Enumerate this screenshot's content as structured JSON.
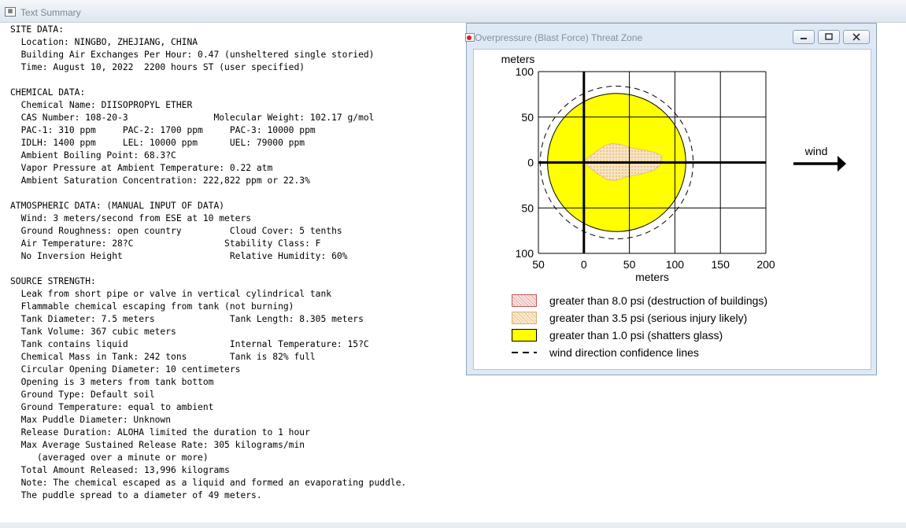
{
  "window": {
    "title": "Text Summary"
  },
  "report": {
    "lines": [
      "SITE DATA:",
      "  Location: NINGBO, ZHEJIANG, CHINA",
      "  Building Air Exchanges Per Hour: 0.47 (unsheltered single storied)",
      "  Time: August 10, 2022  2200 hours ST (user specified)",
      "",
      "CHEMICAL DATA:",
      "  Chemical Name: DIISOPROPYL ETHER",
      "  CAS Number: 108-20-3                Molecular Weight: 102.17 g/mol",
      "  PAC-1: 310 ppm     PAC-2: 1700 ppm     PAC-3: 10000 ppm",
      "  IDLH: 1400 ppm     LEL: 10000 ppm      UEL: 79000 ppm",
      "  Ambient Boiling Point: 68.3?C",
      "  Vapor Pressure at Ambient Temperature: 0.22 atm",
      "  Ambient Saturation Concentration: 222,822 ppm or 22.3%",
      "",
      "ATMOSPHERIC DATA: (MANUAL INPUT OF DATA)",
      "  Wind: 3 meters/second from ESE at 10 meters",
      "  Ground Roughness: open country         Cloud Cover: 5 tenths",
      "  Air Temperature: 28?C                 Stability Class: F",
      "  No Inversion Height                    Relative Humidity: 60%",
      "",
      "SOURCE STRENGTH:",
      "  Leak from short pipe or valve in vertical cylindrical tank",
      "  Flammable chemical escaping from tank (not burning)",
      "  Tank Diameter: 7.5 meters              Tank Length: 8.305 meters",
      "  Tank Volume: 367 cubic meters",
      "  Tank contains liquid                   Internal Temperature: 15?C",
      "  Chemical Mass in Tank: 242 tons        Tank is 82% full",
      "  Circular Opening Diameter: 10 centimeters",
      "  Opening is 3 meters from tank bottom",
      "  Ground Type: Default soil",
      "  Ground Temperature: equal to ambient",
      "  Max Puddle Diameter: Unknown",
      "  Release Duration: ALOHA limited the duration to 1 hour",
      "  Max Average Sustained Release Rate: 305 kilograms/min",
      "     (averaged over a minute or more)",
      "  Total Amount Released: 13,996 kilograms",
      "  Note: The chemical escaped as a liquid and formed an evaporating puddle.",
      "  The puddle spread to a diameter of 49 meters."
    ]
  },
  "threat_window": {
    "title": "Overpressure (Blast Force) Threat Zone",
    "buttons": [
      "minimize-icon",
      "maximize-icon",
      "close-icon"
    ]
  },
  "chart_data": {
    "type": "area",
    "xlabel": "meters",
    "ylabel": "meters",
    "xlim": [
      -50,
      200
    ],
    "ylim": [
      -100,
      100
    ],
    "x_ticks": [
      -50,
      0,
      50,
      100,
      150,
      200
    ],
    "x_tick_labels": [
      "50",
      "0",
      "50",
      "100",
      "150",
      "200"
    ],
    "y_ticks": [
      100,
      50,
      0,
      -50,
      -100
    ],
    "y_tick_labels": [
      "100",
      "50",
      "0",
      "50",
      "100"
    ],
    "grid": true,
    "wind_label": "wind",
    "zones": [
      {
        "name": "greater than 8.0 psi (destruction of buildings)",
        "color": "#f4c8c8",
        "points": []
      },
      {
        "name": "greater than 3.5 psi (serious injury likely)",
        "color": "#f6ddb4",
        "points": [
          [
            0,
            0
          ],
          [
            4,
            5
          ],
          [
            12,
            11
          ],
          [
            22,
            18
          ],
          [
            30,
            21
          ],
          [
            40,
            20
          ],
          [
            52,
            16
          ],
          [
            64,
            14
          ],
          [
            78,
            11
          ],
          [
            86,
            7
          ],
          [
            84,
            -3
          ],
          [
            76,
            -9
          ],
          [
            62,
            -13
          ],
          [
            46,
            -16
          ],
          [
            34,
            -20
          ],
          [
            26,
            -19
          ],
          [
            16,
            -13
          ],
          [
            8,
            -7
          ],
          [
            3,
            -3
          ]
        ]
      },
      {
        "name": "greater than 1.0 psi (shatters glass)",
        "color": "#ffff00",
        "center": [
          36,
          0
        ],
        "radius": 76
      }
    ],
    "confidence_lines": {
      "name": "wind direction confidence lines",
      "center": [
        36,
        0
      ],
      "radius": 84
    },
    "legend": [
      {
        "label": "greater than 8.0 psi (destruction of buildings)",
        "swatch": "red-dots"
      },
      {
        "label": "greater than 3.5 psi (serious injury likely)",
        "swatch": "orange-dots"
      },
      {
        "label": "greater than 1.0 psi (shatters glass)",
        "swatch": "yellow"
      },
      {
        "label": "wind direction confidence lines",
        "swatch": "dashed"
      }
    ]
  }
}
